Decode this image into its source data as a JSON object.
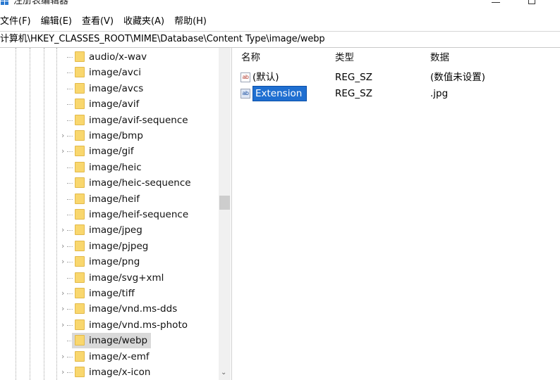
{
  "window": {
    "title": "注册表编辑器"
  },
  "menu": [
    "文件(F)",
    "编辑(E)",
    "查看(V)",
    "收藏夹(A)",
    "帮助(H)"
  ],
  "address": {
    "path": "计算机\\HKEY_CLASSES_ROOT\\MIME\\Database\\Content Type\\image/webp"
  },
  "tree": {
    "items": [
      {
        "label": "audio/x-wav",
        "has_children": false
      },
      {
        "label": "image/avci",
        "has_children": false
      },
      {
        "label": "image/avcs",
        "has_children": false
      },
      {
        "label": "image/avif",
        "has_children": false
      },
      {
        "label": "image/avif-sequence",
        "has_children": false
      },
      {
        "label": "image/bmp",
        "has_children": true
      },
      {
        "label": "image/gif",
        "has_children": true
      },
      {
        "label": "image/heic",
        "has_children": false
      },
      {
        "label": "image/heic-sequence",
        "has_children": false
      },
      {
        "label": "image/heif",
        "has_children": false
      },
      {
        "label": "image/heif-sequence",
        "has_children": false
      },
      {
        "label": "image/jpeg",
        "has_children": true
      },
      {
        "label": "image/pjpeg",
        "has_children": true
      },
      {
        "label": "image/png",
        "has_children": true
      },
      {
        "label": "image/svg+xml",
        "has_children": false
      },
      {
        "label": "image/tiff",
        "has_children": true
      },
      {
        "label": "image/vnd.ms-dds",
        "has_children": true
      },
      {
        "label": "image/vnd.ms-photo",
        "has_children": true
      },
      {
        "label": "image/webp",
        "has_children": false,
        "selected": true
      },
      {
        "label": "image/x-emf",
        "has_children": true
      },
      {
        "label": "image/x-icon",
        "has_children": true
      }
    ]
  },
  "values": {
    "columns": {
      "name": "名称",
      "type": "类型",
      "data": "数据"
    },
    "rows": [
      {
        "icon": "ab-string-icon",
        "name": "(默认)",
        "type": "REG_SZ",
        "data": "(数值未设置)"
      },
      {
        "icon": "ab-string-icon",
        "name": "Extension",
        "type": "REG_SZ",
        "data": ".jpg",
        "editing": true
      }
    ]
  },
  "colors": {
    "selection_edit": "#1f6fd1",
    "tree_selected": "#d9d9d9",
    "folder": "#f9d76e"
  }
}
